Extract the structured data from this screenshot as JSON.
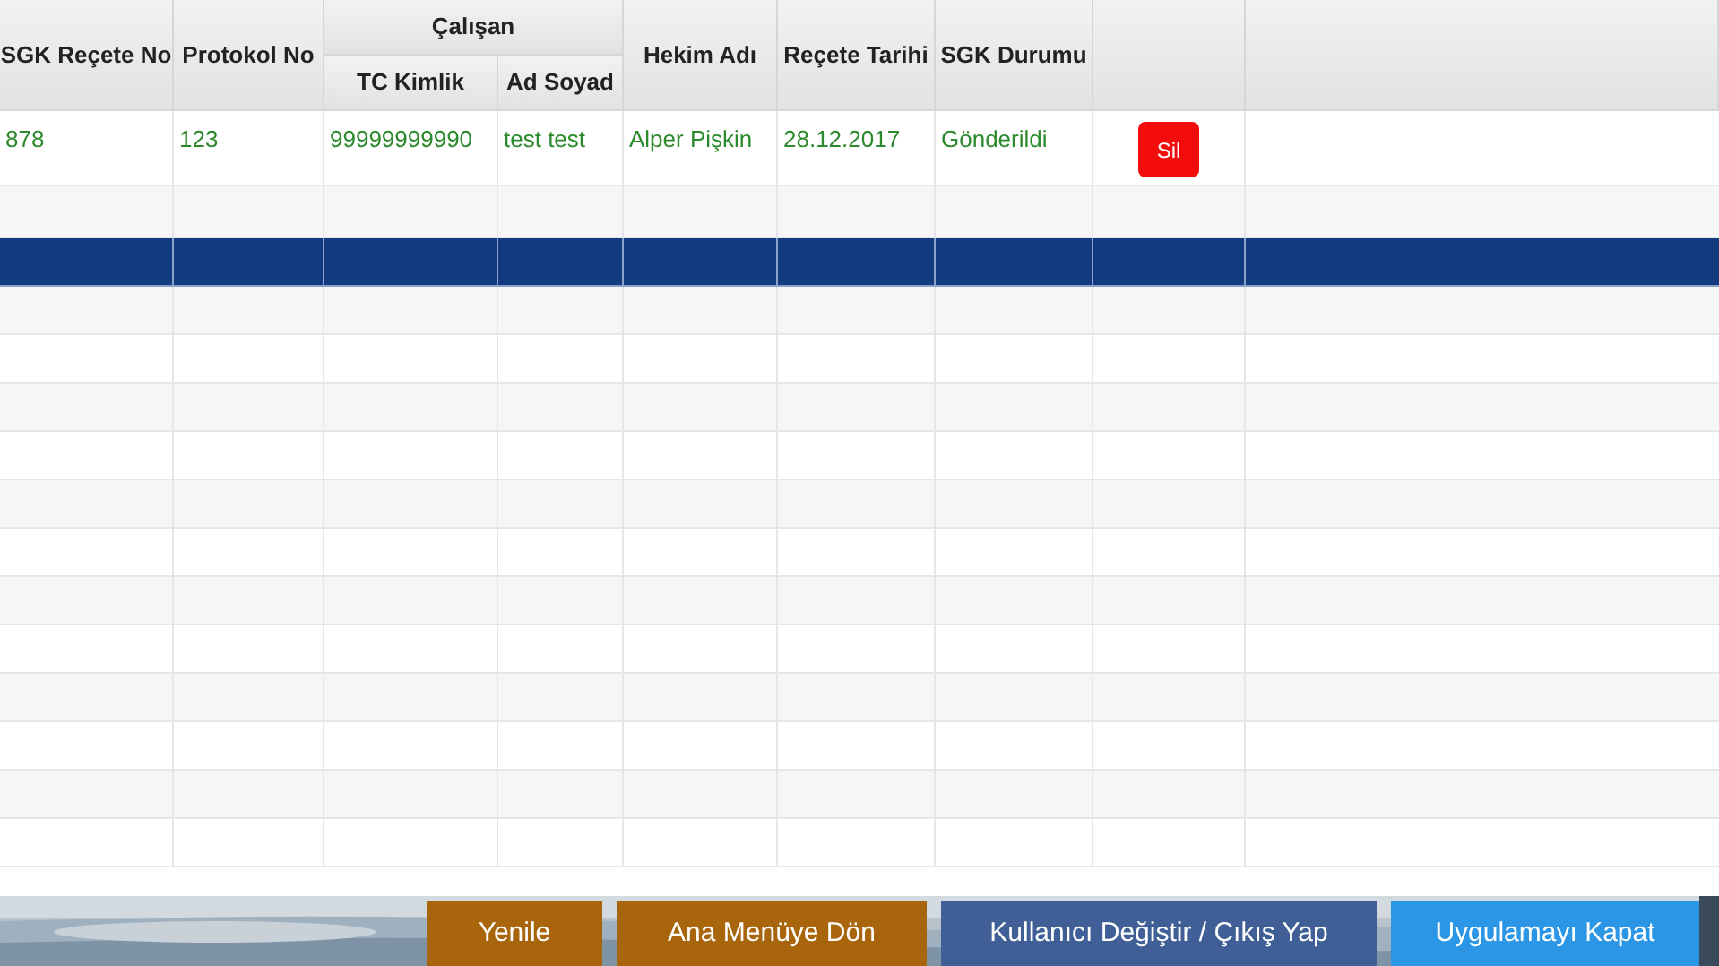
{
  "table": {
    "columns": [
      {
        "label": "SGK Reçete No"
      },
      {
        "label": "Protokol No"
      },
      {
        "group": "Çalışan",
        "children": [
          {
            "label": "TC Kimlik"
          },
          {
            "label": "Ad Soyad"
          }
        ]
      },
      {
        "label": "Hekim Adı"
      },
      {
        "label": "Reçete Tarihi"
      },
      {
        "label": "SGK Durumu"
      }
    ],
    "rows": [
      {
        "selected": false,
        "cells": [
          "878",
          "123",
          "99999999990",
          "test test",
          "Alper Pişkin",
          "28.12.2017",
          "Gönderildi"
        ],
        "action": "Sil"
      },
      {
        "selected": false
      },
      {
        "selected": true
      },
      {
        "selected": false
      },
      {
        "selected": false
      },
      {
        "selected": false
      },
      {
        "selected": false
      },
      {
        "selected": false
      },
      {
        "selected": false
      },
      {
        "selected": false
      },
      {
        "selected": false
      },
      {
        "selected": false
      },
      {
        "selected": false
      },
      {
        "selected": false
      },
      {
        "selected": false
      }
    ]
  },
  "footer": {
    "buttons": [
      {
        "label": "Yenile",
        "kind": "refresh"
      },
      {
        "label": "Ana Menüye Dön",
        "kind": "menu"
      },
      {
        "label": "Kullanıcı Değiştir / Çıkış Yap",
        "kind": "logout"
      },
      {
        "label": "Uygulamayı Kapat",
        "kind": "close"
      }
    ]
  }
}
